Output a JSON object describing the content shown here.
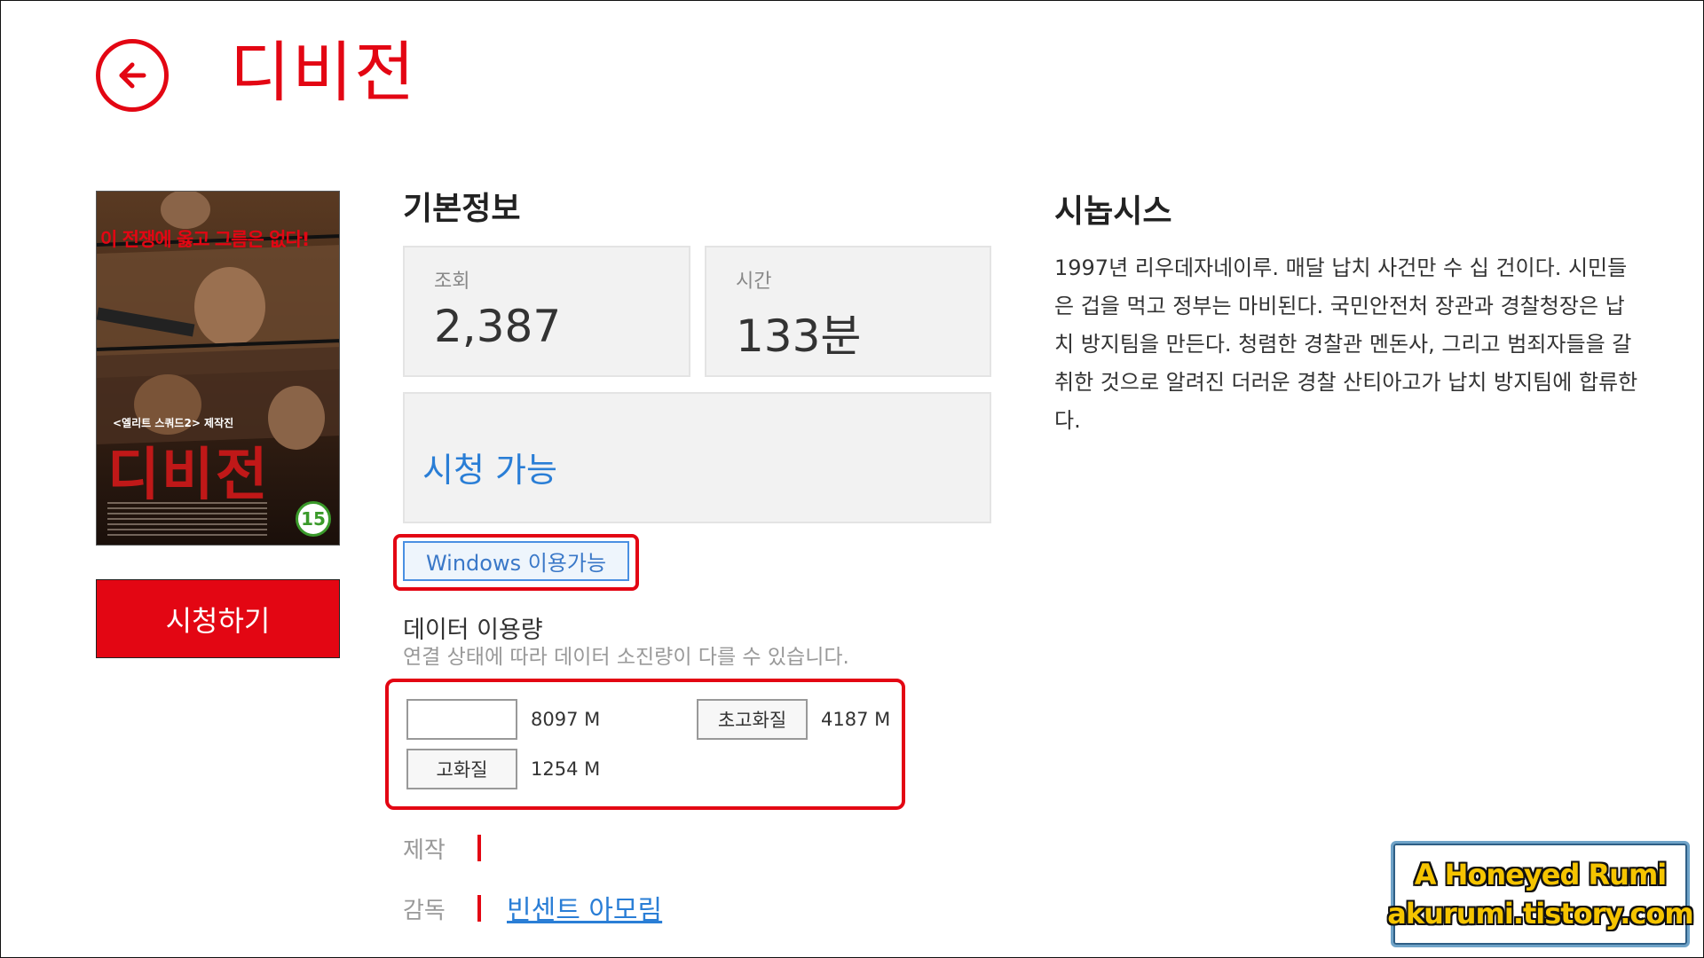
{
  "header": {
    "title": "디비전",
    "back_icon": "arrow-left-icon"
  },
  "poster": {
    "tagline": "이 전쟁에 옳고 그름은 없다!",
    "subtitle": "<엘리트 스쿼드2> 제작진",
    "title": "디비전",
    "rating": "15"
  },
  "actions": {
    "watch_label": "시청하기"
  },
  "basic_info": {
    "title": "기본정보",
    "views_label": "조회",
    "views_value": "2,387",
    "time_label": "시간",
    "time_value": "133분",
    "availability": "시청 가능",
    "platform_badge": "Windows 이용가능"
  },
  "data_usage": {
    "title": "데이터 이용량",
    "note": "연결 상태에 따라 데이터 소진량이 다를  수 있습니다.",
    "options": [
      {
        "label": "",
        "size": "8097 M"
      },
      {
        "label": "초고화질",
        "size": "4187 M"
      },
      {
        "label": "고화질",
        "size": "1254 M"
      }
    ]
  },
  "credits": {
    "producer_label": "제작",
    "producer_value": "",
    "director_label": "감독",
    "director_value": "빈센트 아모림"
  },
  "synopsis": {
    "title": "시놉시스",
    "text": "1997년 리우데자네이루. 매달 납치 사건만 수 십 건이다. 시민들은 겁을 먹고 정부는 마비된다. 국민안전처 장관과 경찰청장은 납치 방지팀을 만든다. 청렴한 경찰관 멘돈사, 그리고 범죄자들을 갈취한 것으로 알려진 더러운 경찰 산티아고가 납치 방지팀에 합류한다."
  },
  "watermark": {
    "line1": "A Honeyed Rumi",
    "line2": "akurumi.tistory.com"
  },
  "colors": {
    "accent": "#e30613",
    "link": "#2a7ed6"
  }
}
